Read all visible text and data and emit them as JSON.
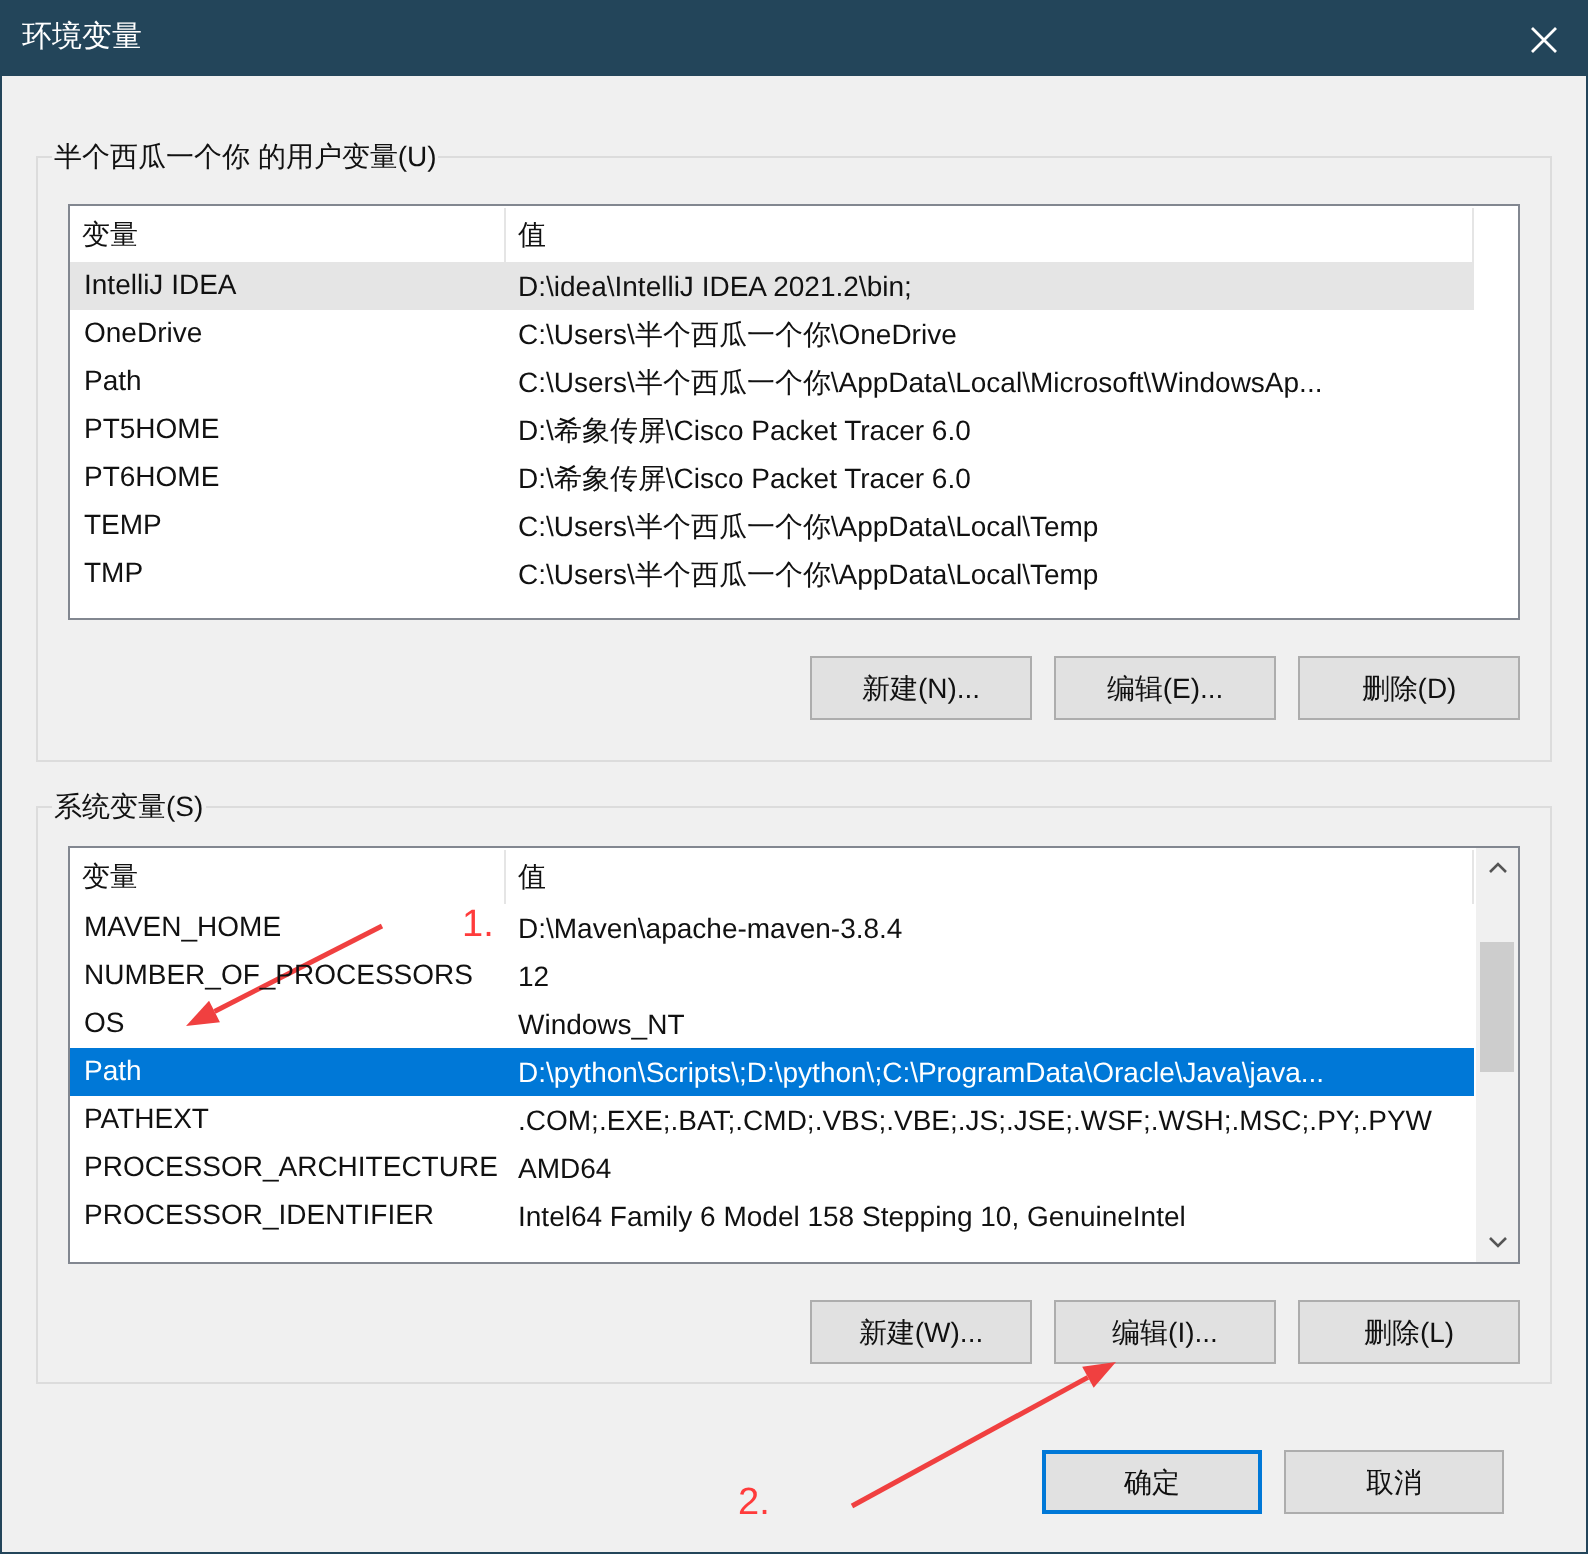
{
  "window": {
    "title": "环境变量"
  },
  "groups": [
    {
      "title": "半个西瓜一个你 的用户变量(U)",
      "focused": false,
      "scrollbar": false,
      "columns": [
        "变量",
        "值"
      ],
      "rows": [
        {
          "name": "IntelliJ IDEA",
          "value": "D:\\idea\\IntelliJ IDEA 2021.2\\bin;",
          "selected": true
        },
        {
          "name": "OneDrive",
          "value": "C:\\Users\\半个西瓜一个你\\OneDrive",
          "selected": false
        },
        {
          "name": "Path",
          "value": "C:\\Users\\半个西瓜一个你\\AppData\\Local\\Microsoft\\WindowsAp...",
          "selected": false
        },
        {
          "name": "PT5HOME",
          "value": "D:\\希象传屏\\Cisco Packet Tracer 6.0",
          "selected": false
        },
        {
          "name": "PT6HOME",
          "value": "D:\\希象传屏\\Cisco Packet Tracer 6.0",
          "selected": false
        },
        {
          "name": "TEMP",
          "value": "C:\\Users\\半个西瓜一个你\\AppData\\Local\\Temp",
          "selected": false
        },
        {
          "name": "TMP",
          "value": "C:\\Users\\半个西瓜一个你\\AppData\\Local\\Temp",
          "selected": false
        }
      ],
      "buttons": [
        "新建(N)...",
        "编辑(E)...",
        "删除(D)"
      ]
    },
    {
      "title": "系统变量(S)",
      "focused": true,
      "scrollbar": true,
      "columns": [
        "变量",
        "值"
      ],
      "rows": [
        {
          "name": "MAVEN_HOME",
          "value": "D:\\Maven\\apache-maven-3.8.4",
          "selected": false
        },
        {
          "name": "NUMBER_OF_PROCESSORS",
          "value": "12",
          "selected": false
        },
        {
          "name": "OS",
          "value": "Windows_NT",
          "selected": false
        },
        {
          "name": "Path",
          "value": "D:\\python\\Scripts\\;D:\\python\\;C:\\ProgramData\\Oracle\\Java\\java...",
          "selected": true
        },
        {
          "name": "PATHEXT",
          "value": ".COM;.EXE;.BAT;.CMD;.VBS;.VBE;.JS;.JSE;.WSF;.WSH;.MSC;.PY;.PYW",
          "selected": false
        },
        {
          "name": "PROCESSOR_ARCHITECTURE",
          "value": "AMD64",
          "selected": false
        },
        {
          "name": "PROCESSOR_IDENTIFIER",
          "value": "Intel64 Family 6 Model 158 Stepping 10, GenuineIntel",
          "selected": false
        }
      ],
      "buttons": [
        "新建(W)...",
        "编辑(I)...",
        "删除(L)"
      ]
    }
  ],
  "dialog_buttons": [
    {
      "label": "确定",
      "default": true
    },
    {
      "label": "取消",
      "default": false
    }
  ],
  "annotations": [
    {
      "label": "1."
    },
    {
      "label": "2."
    }
  ]
}
